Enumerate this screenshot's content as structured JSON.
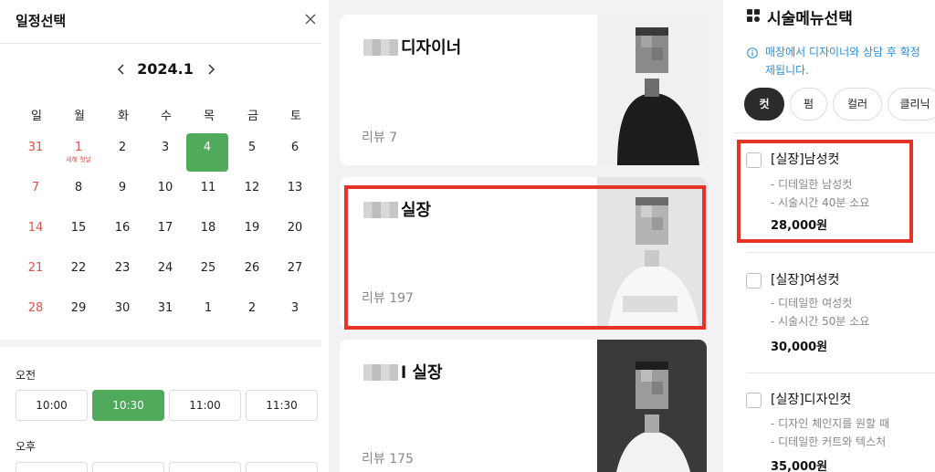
{
  "schedule": {
    "title": "일정선택",
    "month_label": "2024.1",
    "weekdays": [
      "일",
      "월",
      "화",
      "수",
      "목",
      "금",
      "토"
    ],
    "weeks": [
      [
        {
          "d": "31",
          "c": "sun"
        },
        {
          "d": "1",
          "c": "hol",
          "sub": "새해 첫날"
        },
        {
          "d": "2"
        },
        {
          "d": "3"
        },
        {
          "d": "4",
          "c": "sel"
        },
        {
          "d": "5"
        },
        {
          "d": "6"
        }
      ],
      [
        {
          "d": "7",
          "c": "sun"
        },
        {
          "d": "8"
        },
        {
          "d": "9"
        },
        {
          "d": "10"
        },
        {
          "d": "11"
        },
        {
          "d": "12"
        },
        {
          "d": "13"
        }
      ],
      [
        {
          "d": "14",
          "c": "sun"
        },
        {
          "d": "15"
        },
        {
          "d": "16"
        },
        {
          "d": "17"
        },
        {
          "d": "18"
        },
        {
          "d": "19"
        },
        {
          "d": "20"
        }
      ],
      [
        {
          "d": "21",
          "c": "sun"
        },
        {
          "d": "22"
        },
        {
          "d": "23"
        },
        {
          "d": "24"
        },
        {
          "d": "25"
        },
        {
          "d": "26"
        },
        {
          "d": "27"
        }
      ],
      [
        {
          "d": "28",
          "c": "sun"
        },
        {
          "d": "29"
        },
        {
          "d": "30"
        },
        {
          "d": "31"
        },
        {
          "d": "1"
        },
        {
          "d": "2"
        },
        {
          "d": "3"
        }
      ]
    ],
    "am_label": "오전",
    "am_slots": [
      "10:00",
      "10:30",
      "11:00",
      "11:30"
    ],
    "selected_slot": "10:30",
    "pm_label": "오후"
  },
  "designers": [
    {
      "name": "디자이너",
      "reviews": "리뷰 7"
    },
    {
      "name": "실장",
      "reviews": "리뷰 197"
    },
    {
      "name": "l 실장",
      "reviews": "리뷰 175"
    }
  ],
  "services": {
    "title": "시술메뉴선택",
    "notice": "매장에서 디자이너와 상담 후 확정\n제됩니다.",
    "categories": [
      "컷",
      "펌",
      "컬러",
      "클리닉"
    ],
    "selected_category": "컷",
    "items": [
      {
        "name": "[실장]남성컷",
        "desc": [
          "- 디테일한 남성컷",
          "- 시술시간 40분 소요"
        ],
        "price": "28,000원"
      },
      {
        "name": "[실장]여성컷",
        "desc": [
          "- 디테일한 여성컷",
          "- 시술시간 50분 소요"
        ],
        "price": "30,000원"
      },
      {
        "name": "[실장]디자인컷",
        "desc": [
          "- 디자인 체인지를 원할 때",
          "- 디테일한 커트와 텍스처"
        ],
        "price": "35,000원"
      }
    ]
  },
  "colors": {
    "accent_green": "#4faa5c",
    "holiday_red": "#d9534f",
    "highlight_red": "#e53325",
    "info_blue": "#2a8fd8"
  }
}
